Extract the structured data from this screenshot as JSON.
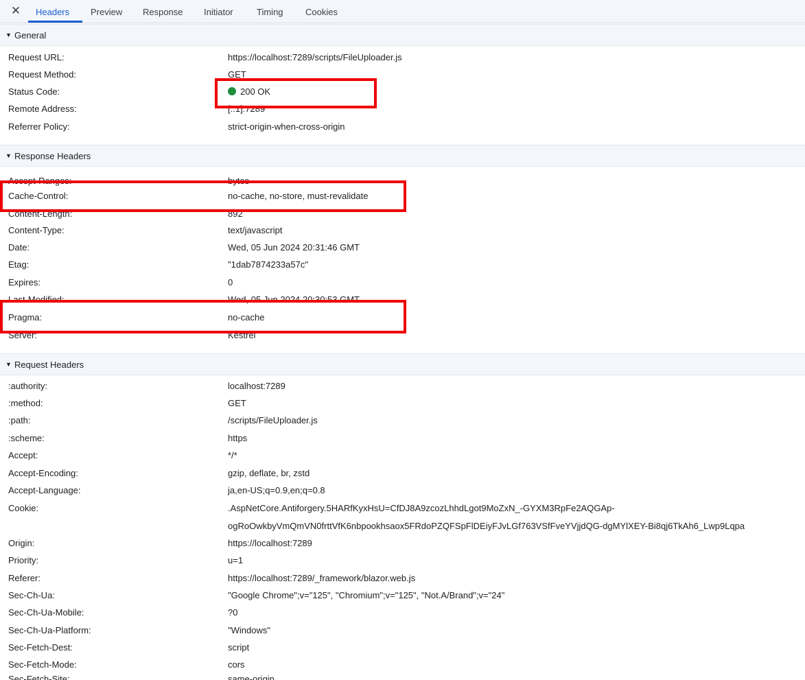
{
  "tabs": [
    {
      "label": "Headers"
    },
    {
      "label": "Preview"
    },
    {
      "label": "Response"
    },
    {
      "label": "Initiator"
    },
    {
      "label": "Timing"
    },
    {
      "label": "Cookies"
    }
  ],
  "close_glyph": "✕",
  "sections": {
    "general": {
      "title": "General",
      "rows": [
        {
          "key": "Request URL:",
          "value": "https://localhost:7289/scripts/FileUploader.js"
        },
        {
          "key": "Request Method:",
          "value": "GET"
        },
        {
          "key": "Status Code:",
          "value": "200 OK"
        },
        {
          "key": "Remote Address:",
          "value": "[::1]:7289"
        },
        {
          "key": "Referrer Policy:",
          "value": "strict-origin-when-cross-origin"
        }
      ]
    },
    "response": {
      "title": "Response Headers",
      "rows": [
        {
          "key": "Accept-Ranges:",
          "value": "bytes"
        },
        {
          "key": "Cache-Control:",
          "value": "no-cache, no-store, must-revalidate"
        },
        {
          "key": "Content-Length:",
          "value": "892"
        },
        {
          "key": "Content-Type:",
          "value": "text/javascript"
        },
        {
          "key": "Date:",
          "value": "Wed, 05 Jun 2024 20:31:46 GMT"
        },
        {
          "key": "Etag:",
          "value": "\"1dab7874233a57c\""
        },
        {
          "key": "Expires:",
          "value": "0"
        },
        {
          "key": "Last-Modified:",
          "value": "Wed, 05 Jun 2024 20:30:53 GMT"
        },
        {
          "key": "Pragma:",
          "value": "no-cache"
        },
        {
          "key": "Server:",
          "value": "Kestrel"
        }
      ]
    },
    "request": {
      "title": "Request Headers",
      "rows": [
        {
          "key": ":authority:",
          "value": "localhost:7289"
        },
        {
          "key": ":method:",
          "value": "GET"
        },
        {
          "key": ":path:",
          "value": "/scripts/FileUploader.js"
        },
        {
          "key": ":scheme:",
          "value": "https"
        },
        {
          "key": "Accept:",
          "value": "*/*"
        },
        {
          "key": "Accept-Encoding:",
          "value": "gzip, deflate, br, zstd"
        },
        {
          "key": "Accept-Language:",
          "value": "ja,en-US;q=0.9,en;q=0.8"
        },
        {
          "key": "Cookie:",
          "value": ".AspNetCore.Antiforgery.5HARfKyxHsU=CfDJ8A9zcozLhhdLgot9MoZxN_-GYXM3RpFe2AQGAp-",
          "value_line2": "ogRoOwkbyVmQmVN0frttVfK6nbpookhsaox5FRdoPZQFSpFlDEiyFJvLGf763VSfFveYVjjdQG-dgMYlXEY-Bi8qj6TkAh6_Lwp9Lqpa"
        },
        {
          "key": "Origin:",
          "value": "https://localhost:7289"
        },
        {
          "key": "Priority:",
          "value": "u=1"
        },
        {
          "key": "Referer:",
          "value": "https://localhost:7289/_framework/blazor.web.js"
        },
        {
          "key": "Sec-Ch-Ua:",
          "value": "\"Google Chrome\";v=\"125\", \"Chromium\";v=\"125\", \"Not.A/Brand\";v=\"24\""
        },
        {
          "key": "Sec-Ch-Ua-Mobile:",
          "value": "?0"
        },
        {
          "key": "Sec-Ch-Ua-Platform:",
          "value": "\"Windows\""
        },
        {
          "key": "Sec-Fetch-Dest:",
          "value": "script"
        },
        {
          "key": "Sec-Fetch-Mode:",
          "value": "cors"
        },
        {
          "key": "Sec-Fetch-Site:",
          "value": "same-origin"
        }
      ]
    }
  },
  "colors": {
    "accent": "#1a5fd0",
    "status_ok": "#1e8e3e",
    "highlight_box": "#ee0000"
  }
}
